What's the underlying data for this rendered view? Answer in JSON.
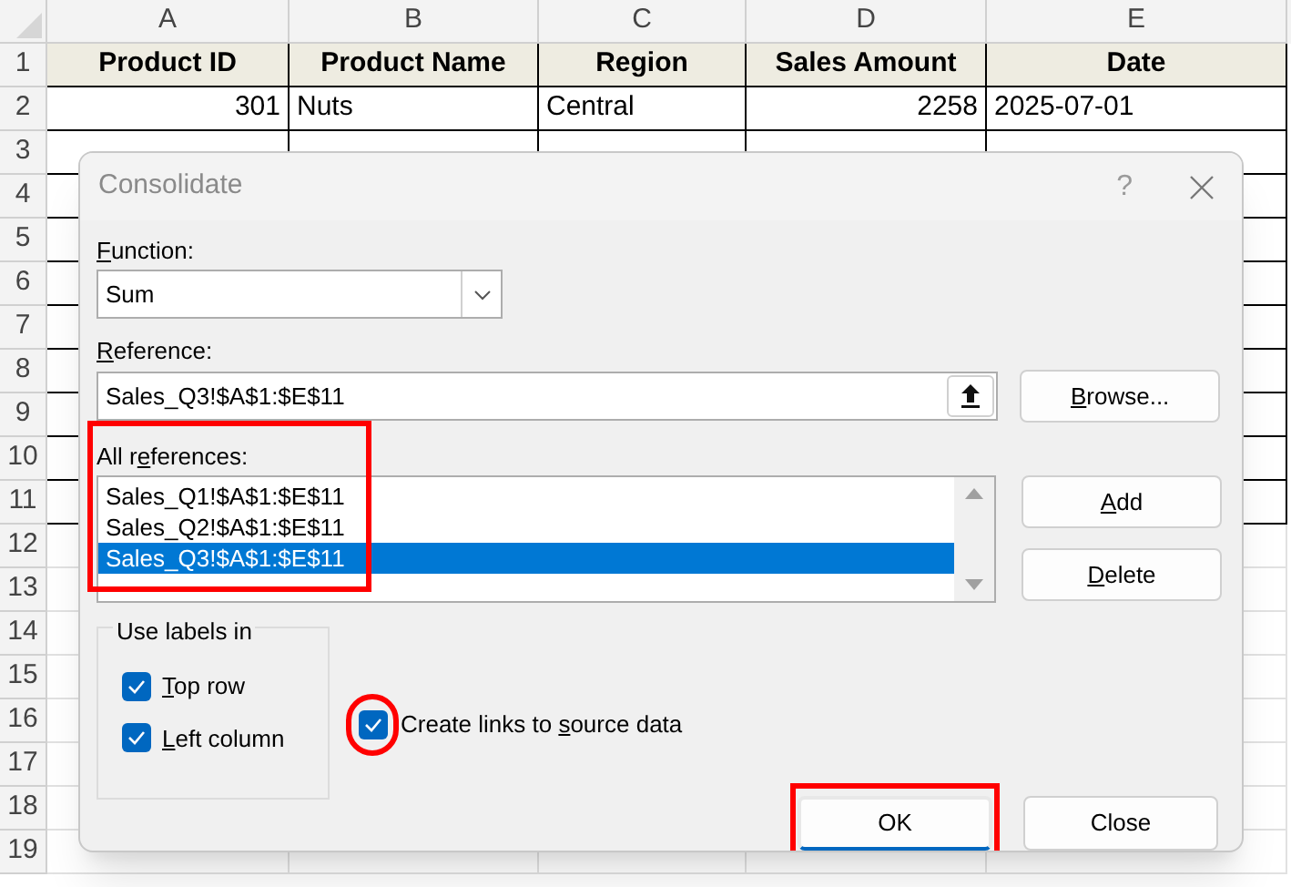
{
  "spreadsheet": {
    "columns": [
      {
        "letter": "A",
        "numeric": true
      },
      {
        "letter": "B",
        "numeric": false
      },
      {
        "letter": "C",
        "numeric": false
      },
      {
        "letter": "D",
        "numeric": true
      },
      {
        "letter": "E",
        "numeric": false
      }
    ],
    "row_numbers": [
      "1",
      "2",
      "3",
      "4",
      "5",
      "6",
      "7",
      "8",
      "9",
      "10",
      "11",
      "12",
      "13",
      "14",
      "15",
      "16",
      "17",
      "18",
      "19"
    ],
    "header_row": [
      "Product ID",
      "Product Name",
      "Region",
      "Sales Amount",
      "Date"
    ],
    "rows": [
      [
        "301",
        "Nuts",
        "Central",
        "2258",
        "2025-07-01"
      ]
    ]
  },
  "dialog": {
    "title": "Consolidate",
    "help": "?",
    "function": {
      "label": {
        "key": "F",
        "after": "unction:"
      },
      "value": "Sum"
    },
    "reference": {
      "label": {
        "key": "R",
        "after": "eference:"
      },
      "value": "Sales_Q3!$A$1:$E$11"
    },
    "all_references": {
      "label": {
        "before": "All r",
        "key": "e",
        "after": "ferences:"
      },
      "marked": true,
      "items": [
        {
          "text": "Sales_Q1!$A$1:$E$11",
          "selected": false
        },
        {
          "text": "Sales_Q2!$A$1:$E$11",
          "selected": false
        },
        {
          "text": "Sales_Q3!$A$1:$E$11",
          "selected": true
        }
      ]
    },
    "browse": {
      "key": "B",
      "after": "rowse..."
    },
    "side_buttons": [
      {
        "label": {
          "key": "A",
          "after": "dd"
        }
      },
      {
        "label": {
          "key": "D",
          "after": "elete"
        }
      }
    ],
    "use_labels": {
      "title": "Use labels in",
      "options": [
        {
          "label": {
            "key": "T",
            "after": "op row"
          },
          "checked": true
        },
        {
          "label": {
            "key": "L",
            "after": "eft column"
          },
          "checked": true
        }
      ]
    },
    "create_links": {
      "label": {
        "before": "Create links to ",
        "key": "s",
        "after": "ource data"
      },
      "checked": true,
      "marked": true
    },
    "buttons": [
      {
        "label": "OK",
        "default": true,
        "marked": true
      },
      {
        "label": "Close",
        "default": false,
        "marked": false
      }
    ]
  }
}
